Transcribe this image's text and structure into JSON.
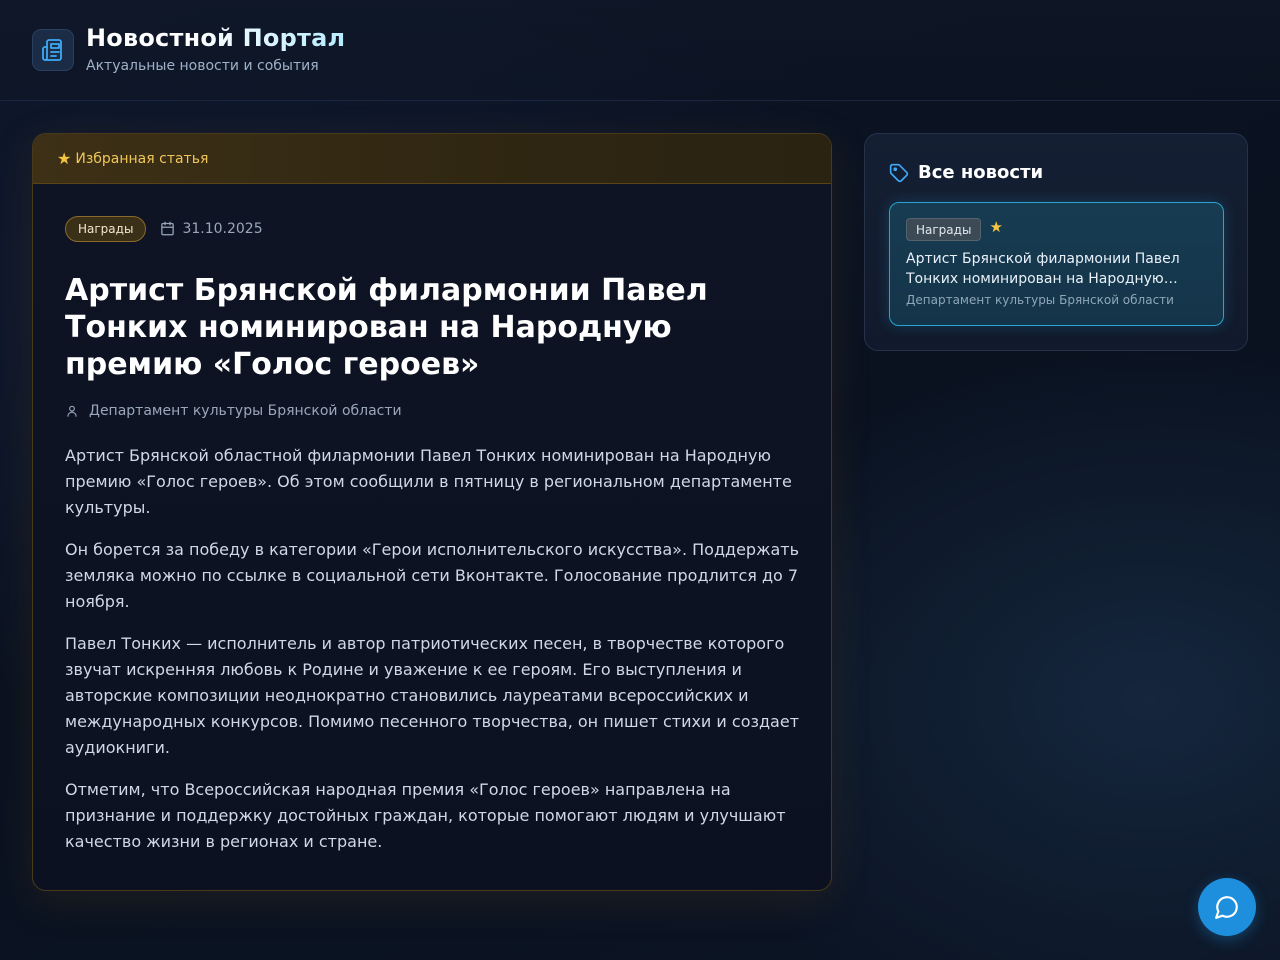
{
  "header": {
    "title": "Новостной Портал",
    "subtitle": "Актуальные новости и события",
    "logo_icon": "newspaper-icon"
  },
  "article": {
    "featured_label": "Избранная статья",
    "category": "Награды",
    "date": "31.10.2025",
    "title": "Артист Брянской филармонии Павел Тонких номинирован на Народную премию «Голос героев»",
    "author": "Департамент культуры Брянской области",
    "paragraphs": [
      "Артист Брянской областной филармонии Павел Тонких номинирован на Народную премию «Голос героев». Об этом сообщили в пятницу в региональном департаменте культуры.",
      "Он борется за победу в категории «Герои исполнительского искусства». Поддержать земляка можно по ссылке в социальной сети Вконтакте. Голосование продлится до 7 ноября.",
      "Павел Тонких — исполнитель и автор патриотических песен, в творчестве которого звучат искренняя любовь к Родине и уважение к ее героям. Его выступления и авторские композиции неоднократно становились лауреатами всероссийских и международных конкурсов. Помимо песенного творчества, он пишет стихи и создает аудиокниги.",
      "Отметим, что Всероссийская народная премия «Голос героев» направлена на признание и поддержку достойных граждан, которые помогают людям и улучшают качество жизни в регионах и стране."
    ]
  },
  "sidebar": {
    "title": "Все новости",
    "items": [
      {
        "category": "Награды",
        "title": "Артист Брянской филармонии Павел Тонких номинирован на Народную премию «Голос героев»",
        "source": "Департамент культуры Брянской области",
        "featured": true
      }
    ]
  },
  "colors": {
    "accent": "#1e8fdc",
    "featured": "#f5c542",
    "active_card_border": "#2aa3cf"
  }
}
